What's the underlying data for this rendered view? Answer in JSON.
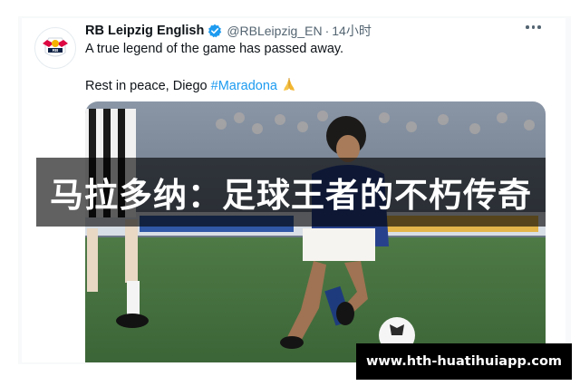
{
  "tweet": {
    "display_name": "RB Leipzig English",
    "handle": "@RBLeipzig_EN",
    "separator": "·",
    "time": "14小时",
    "line1": "A true legend of the game has passed away.",
    "line2_prefix": "Rest in peace, Diego ",
    "hashtag": "#Maradona",
    "avatar_icon": "rb-leipzig-logo-icon",
    "emoji_icon": "folded-hands-icon",
    "more_icon": "more-options-icon"
  },
  "overlay": {
    "title": "马拉多纳：足球王者的不朽传奇",
    "watermark": "www.hth-huatihuiapp.com"
  },
  "colors": {
    "text": "#0f1419",
    "muted": "#536471",
    "link": "#1d9bf0",
    "verified": "#1d9bf0",
    "banner_bg": "#000000",
    "banner_text": "#ffffff"
  }
}
